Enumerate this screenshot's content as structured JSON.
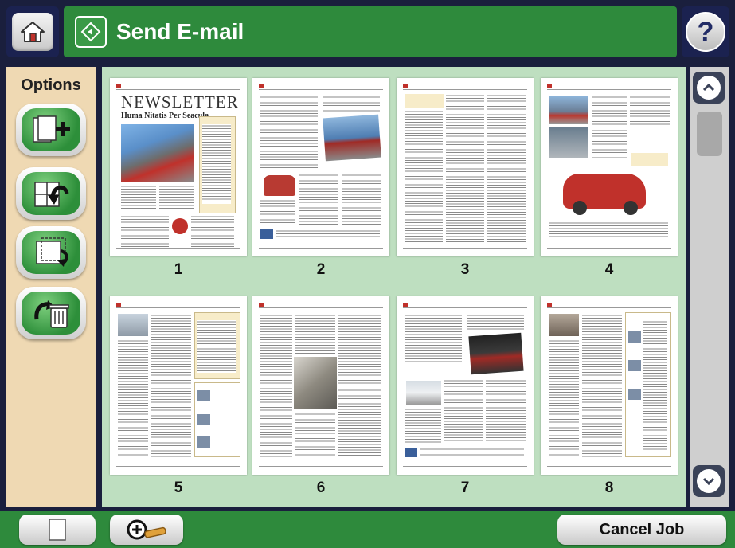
{
  "header": {
    "title": "Send E-mail",
    "help_glyph": "?"
  },
  "icons": {
    "home": "home-icon",
    "app": "send-email-app-icon",
    "help": "help-icon"
  },
  "options": {
    "title": "Options",
    "buttons": [
      {
        "name": "add-pages-button",
        "icon": "add-pages-icon"
      },
      {
        "name": "rotate-page-button",
        "icon": "rotate-icon"
      },
      {
        "name": "move-page-button",
        "icon": "move-page-icon"
      },
      {
        "name": "delete-page-button",
        "icon": "trash-icon"
      }
    ]
  },
  "pages": [
    {
      "number": "1",
      "headline": "NEWSLETTER",
      "subhead": "Huma Nitatis Per Seacula"
    },
    {
      "number": "2"
    },
    {
      "number": "3"
    },
    {
      "number": "4"
    },
    {
      "number": "5"
    },
    {
      "number": "6"
    },
    {
      "number": "7"
    },
    {
      "number": "8"
    }
  ],
  "bottom": {
    "cancel_label": "Cancel Job"
  },
  "colors": {
    "header_green": "#2e8a3c",
    "options_bg": "#efd9b3",
    "preview_bg": "#bedfc0",
    "dark_navy": "#1b2250"
  }
}
